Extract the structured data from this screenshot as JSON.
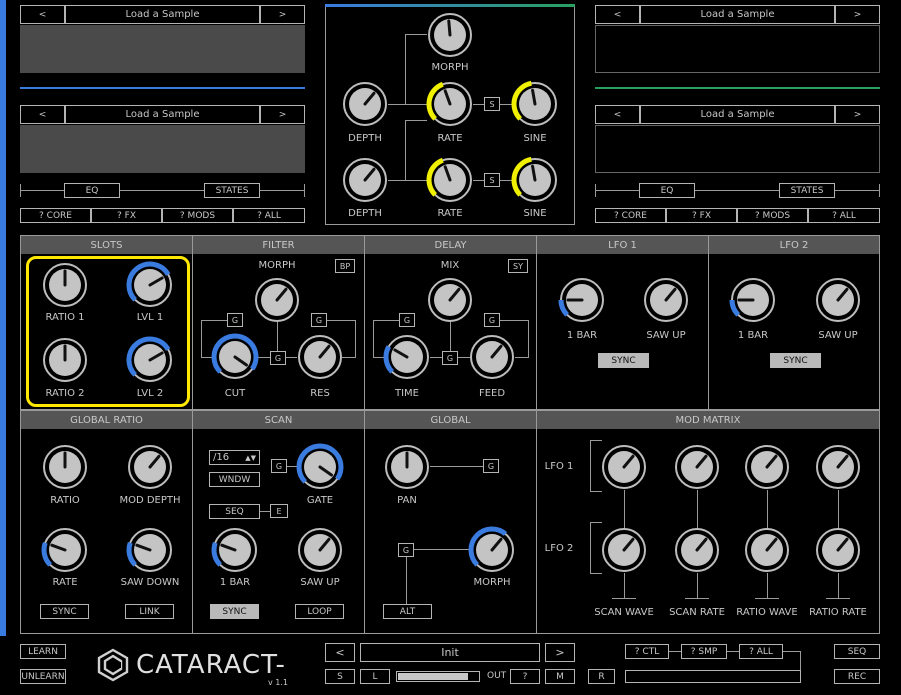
{
  "colors": {
    "accent_blue": "#3a7be0",
    "accent_yellow": "#f0f000",
    "highlight": "#ffe800",
    "panel_header": "#555555",
    "line_green": "#2aa060"
  },
  "sample_left": {
    "prev": "<",
    "next": ">",
    "slot1": "Load a Sample",
    "slot2": "Load a Sample",
    "eq": "EQ",
    "states": "STATES",
    "core": "? CORE",
    "fx": "? FX",
    "mods": "? MODS",
    "all": "? ALL"
  },
  "sample_right": {
    "prev": "<",
    "next": ">",
    "slot1": "Load a Sample",
    "slot2": "Load a Sample",
    "eq": "EQ",
    "states": "STATES",
    "core": "? CORE",
    "fx": "? FX",
    "mods": "? MODS",
    "all": "? ALL"
  },
  "morph_panel": {
    "morph": "MORPH",
    "depth1": "DEPTH",
    "rate1": "RATE",
    "sine1": "SINE",
    "depth2": "DEPTH",
    "rate2": "RATE",
    "sine2": "SINE",
    "s1": "S",
    "s2": "S"
  },
  "slots": {
    "title": "SLOTS",
    "ratio1": "RATIO 1",
    "lvl1": "LVL 1",
    "ratio2": "RATIO 2",
    "lvl2": "LVL 2"
  },
  "filter": {
    "title": "FILTER",
    "morph": "MORPH",
    "mode": "BP",
    "cut": "CUT",
    "res": "RES",
    "g": "G"
  },
  "delay": {
    "title": "DELAY",
    "mix": "MIX",
    "mode": "SY",
    "time": "TIME",
    "feed": "FEED",
    "g": "G"
  },
  "lfo1": {
    "title": "LFO 1",
    "bar": "1 BAR",
    "saw": "SAW UP",
    "sync": "SYNC"
  },
  "lfo2": {
    "title": "LFO 2",
    "bar": "1 BAR",
    "saw": "SAW UP",
    "sync": "SYNC"
  },
  "global_ratio": {
    "title": "GLOBAL RATIO",
    "ratio": "RATIO",
    "mod_depth": "MOD DEPTH",
    "rate": "RATE",
    "saw_down": "SAW DOWN",
    "sync": "SYNC",
    "link": "LINK"
  },
  "scan": {
    "title": "SCAN",
    "division": "/16",
    "wndw": "WNDW",
    "g": "G",
    "gate": "GATE",
    "seq": "SEQ",
    "e": "E",
    "bar": "1 BAR",
    "saw": "SAW UP",
    "sync": "SYNC",
    "loop": "LOOP"
  },
  "global": {
    "title": "GLOBAL",
    "pan": "PAN",
    "g1": "G",
    "g2": "G",
    "morph": "MORPH",
    "alt": "ALT"
  },
  "mod_matrix": {
    "title": "MOD MATRIX",
    "lfo1": "LFO 1",
    "lfo2": "LFO 2",
    "targets": [
      "SCAN WAVE",
      "SCAN RATE",
      "RATIO WAVE",
      "RATIO RATE"
    ]
  },
  "footer": {
    "learn": "LEARN",
    "unlearn": "UNLEARN",
    "logo": "CATARACT-",
    "version": "v 1.1",
    "prev": "<",
    "preset": "Init",
    "next": ">",
    "s": "S",
    "l": "L",
    "out": "OUT",
    "q": "?",
    "m": "M",
    "r": "R",
    "ctl": "? CTL",
    "smp": "? SMP",
    "all": "? ALL",
    "seq": "SEQ",
    "rec": "REC"
  }
}
